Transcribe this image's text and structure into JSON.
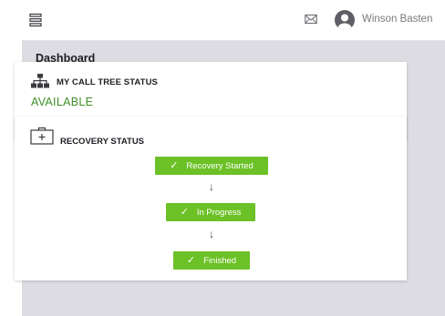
{
  "header": {
    "menu_icon": "hamburger-menu-icon",
    "mail_icon": "envelope-icon",
    "avatar_icon": "user-avatar-icon",
    "user_name": "Winson Basten"
  },
  "page": {
    "title": "Dashboard"
  },
  "call_tree_card": {
    "icon": "org-chart-icon",
    "title": "MY CALL TREE STATUS",
    "status": "AVAILABLE",
    "status_color": "#3f8f28"
  },
  "recovery_card": {
    "icon": "first-aid-kit-icon",
    "title": "RECOVERY STATUS",
    "steps": [
      {
        "label": "Recovery Started",
        "icon": "check-icon"
      },
      {
        "label": "In Progress",
        "icon": "check-icon"
      },
      {
        "label": "Finished",
        "icon": "check-icon"
      }
    ],
    "step_color": "#6cc126",
    "arrow_icon": "arrow-down-icon"
  }
}
